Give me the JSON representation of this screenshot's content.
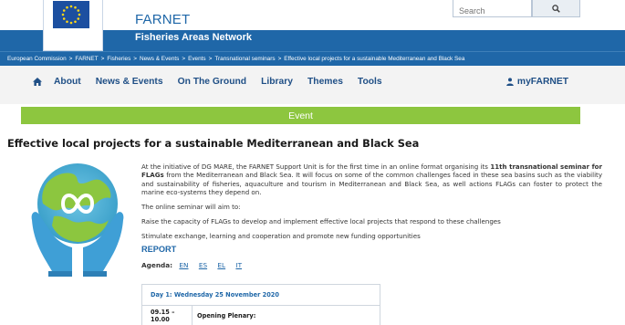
{
  "header": {
    "ec_label_line1": "European",
    "ec_label_line2": "Commission",
    "site_title": "FARNET",
    "site_subtitle": "Fisheries Areas Network",
    "search_placeholder": "Search"
  },
  "breadcrumb": [
    "European Commission",
    "FARNET",
    "Fisheries",
    "News & Events",
    "Events",
    "Transnational seminars",
    "Effective local projects for a sustainable Mediterranean and Black Sea"
  ],
  "nav": {
    "items": [
      "About",
      "News & Events",
      "On The Ground",
      "Library",
      "Themes",
      "Tools"
    ],
    "account": "myFARNET"
  },
  "event_label": "Event",
  "page_title": "Effective local projects for a sustainable Mediterranean and Black Sea",
  "content": {
    "intro_1": "At the initiative of DG MARE, the FARNET Support Unit is for the first time in an online format organising its ",
    "intro_bold": "11th transnational seminar for FLAGs",
    "intro_2": " from the Mediterranean and Black Sea. It will focus on some of the common challenges faced in these sea basins such as the viability and sustainability of fisheries, aquaculture and tourism in Mediterranean and Black Sea, as well actions FLAGs can foster to protect the marine eco-systems they depend on.",
    "aim_intro": "The online seminar will aim to:",
    "aim_1": "Raise the capacity of FLAGs to develop and implement effective local projects that respond to these challenges",
    "aim_2": "Stimulate exchange, learning and cooperation and promote new funding opportunities",
    "report": "REPORT",
    "agenda_label": "Agenda",
    "agenda_languages": [
      "EN",
      "ES",
      "EL",
      "IT"
    ]
  },
  "schedule": {
    "day": "Day 1: Wednesday 25 November 2020",
    "rows": [
      {
        "time": "09.15 – 10.00",
        "session": "Opening Plenary:"
      }
    ]
  },
  "colors": {
    "brand_blue": "#1f67a8",
    "nav_text": "#1f4f86",
    "event_green": "#8dc63f"
  }
}
